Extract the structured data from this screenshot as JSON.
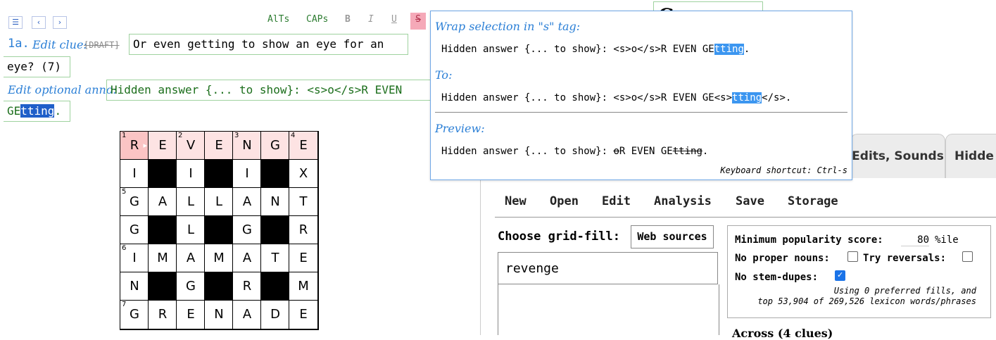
{
  "nav": {
    "menu_icon": "☰",
    "prev_icon": "‹",
    "next_icon": "›"
  },
  "toolbar": {
    "alts": "AlTs",
    "caps": "CAPs",
    "bold": "B",
    "italic": "I",
    "underline": "U",
    "strike": "S"
  },
  "title_fragment": "Crossword",
  "clue": {
    "number": "1a.",
    "edit_label": "Edit clue:",
    "draft_tag": "[DRAFT]",
    "text_line1": "Or even getting to show an eye for an",
    "text_line2": "eye? (7)"
  },
  "anno": {
    "label": "Edit optional anno:",
    "line1": "Hidden answer {... to show}: <s>o</s>R EVEN",
    "line2_pre": "GE",
    "line2_sel": "tting",
    "line2_post": "."
  },
  "grid": {
    "cells": [
      [
        "R",
        "E",
        "V",
        "E",
        "N",
        "G",
        "E"
      ],
      [
        "I",
        "#",
        "I",
        "#",
        "I",
        "#",
        "X"
      ],
      [
        "G",
        "A",
        "L",
        "L",
        "A",
        "N",
        "T"
      ],
      [
        "G",
        "#",
        "L",
        "#",
        "G",
        "#",
        "R"
      ],
      [
        "I",
        "M",
        "A",
        "M",
        "A",
        "T",
        "E"
      ],
      [
        "N",
        "#",
        "G",
        "#",
        "R",
        "#",
        "M"
      ],
      [
        "G",
        "R",
        "E",
        "N",
        "A",
        "D",
        "E"
      ]
    ],
    "numbers": {
      "0-0": "1",
      "0-2": "2",
      "0-4": "3",
      "0-6": "4",
      "2-0": "5",
      "4-0": "6",
      "6-0": "7"
    }
  },
  "popup": {
    "heading1": "Wrap selection in \"s\" tag:",
    "from_pre": "Hidden answer {... to show}: <s>o</s>R EVEN GE",
    "from_sel": "tting",
    "from_post": ".",
    "heading2": "To:",
    "to_pre": "Hidden answer {... to show}: <s>o</s>R EVEN GE<s>",
    "to_sel": "tting",
    "to_post": "</s>.",
    "heading3": "Preview:",
    "prev_pre": "Hidden answer {... to show}: ",
    "prev_strike1": "o",
    "prev_mid": "R EVEN GE",
    "prev_strike2": "tting",
    "prev_post": ".",
    "shortcut": "Keyboard shortcut: Ctrl-s"
  },
  "tabs": {
    "edits": "Edits, Sounds",
    "hidden": "Hidde"
  },
  "menu": {
    "new": "New",
    "open": "Open",
    "edit": "Edit",
    "analysis": "Analysis",
    "save": "Save",
    "storage": "Storage"
  },
  "gridfill": {
    "label": "Choose grid-fill:",
    "source_button": "Web sources",
    "input_value": "revenge"
  },
  "options": {
    "min_pop_label": "Minimum popularity score:",
    "min_pop_value": "80",
    "min_pop_unit": "%ile",
    "no_proper_label": "No proper nouns:",
    "no_proper_checked": false,
    "reversals_label": "Try reversals:",
    "reversals_checked": false,
    "stem_label": "No stem-dupes:",
    "stem_checked": true,
    "note_line1": "Using 0 preferred fills, and",
    "note_line2": "top 53,904 of 269,526 lexicon words/phrases"
  },
  "across_header": "Across (4 clues)"
}
